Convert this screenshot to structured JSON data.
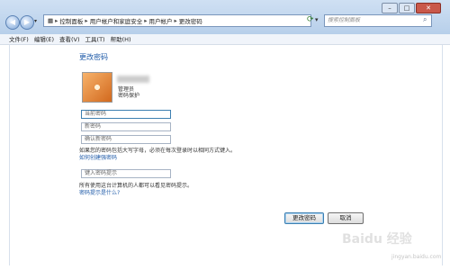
{
  "window": {
    "buttons": {
      "minimize": "–",
      "maximize": "□",
      "close": "✕"
    }
  },
  "nav": {
    "back": "◀",
    "forward": "▶"
  },
  "address": {
    "crumbs": [
      "控制面板",
      "用户帐户和家庭安全",
      "用户帐户",
      "更改密码"
    ],
    "separator": "▸"
  },
  "search": {
    "placeholder": "搜索控制面板"
  },
  "menu": [
    "文件(F)",
    "编辑(E)",
    "查看(V)",
    "工具(T)",
    "帮助(H)"
  ],
  "page": {
    "heading": "更改密码",
    "account_role": "管理员",
    "account_status": "密码保护"
  },
  "form": {
    "current_password_placeholder": "当前密码",
    "new_password_placeholder": "新密码",
    "confirm_password_placeholder": "确认新密码",
    "caps_hint": "如果您的密码包括大写字母，必须在每次登录时以相同方式键入。",
    "strong_password_link": "如何创建强密码",
    "password_hint_placeholder": "键入密码提示",
    "hint_visible_note": "所有使用这台计算机的人都可以看见密码提示。",
    "what_is_hint_link": "密码提示是什么?"
  },
  "actions": {
    "change_password": "更改密码",
    "cancel": "取消"
  },
  "watermark": {
    "text": "Baidu 经验",
    "site": "jingyan.baidu.com"
  }
}
